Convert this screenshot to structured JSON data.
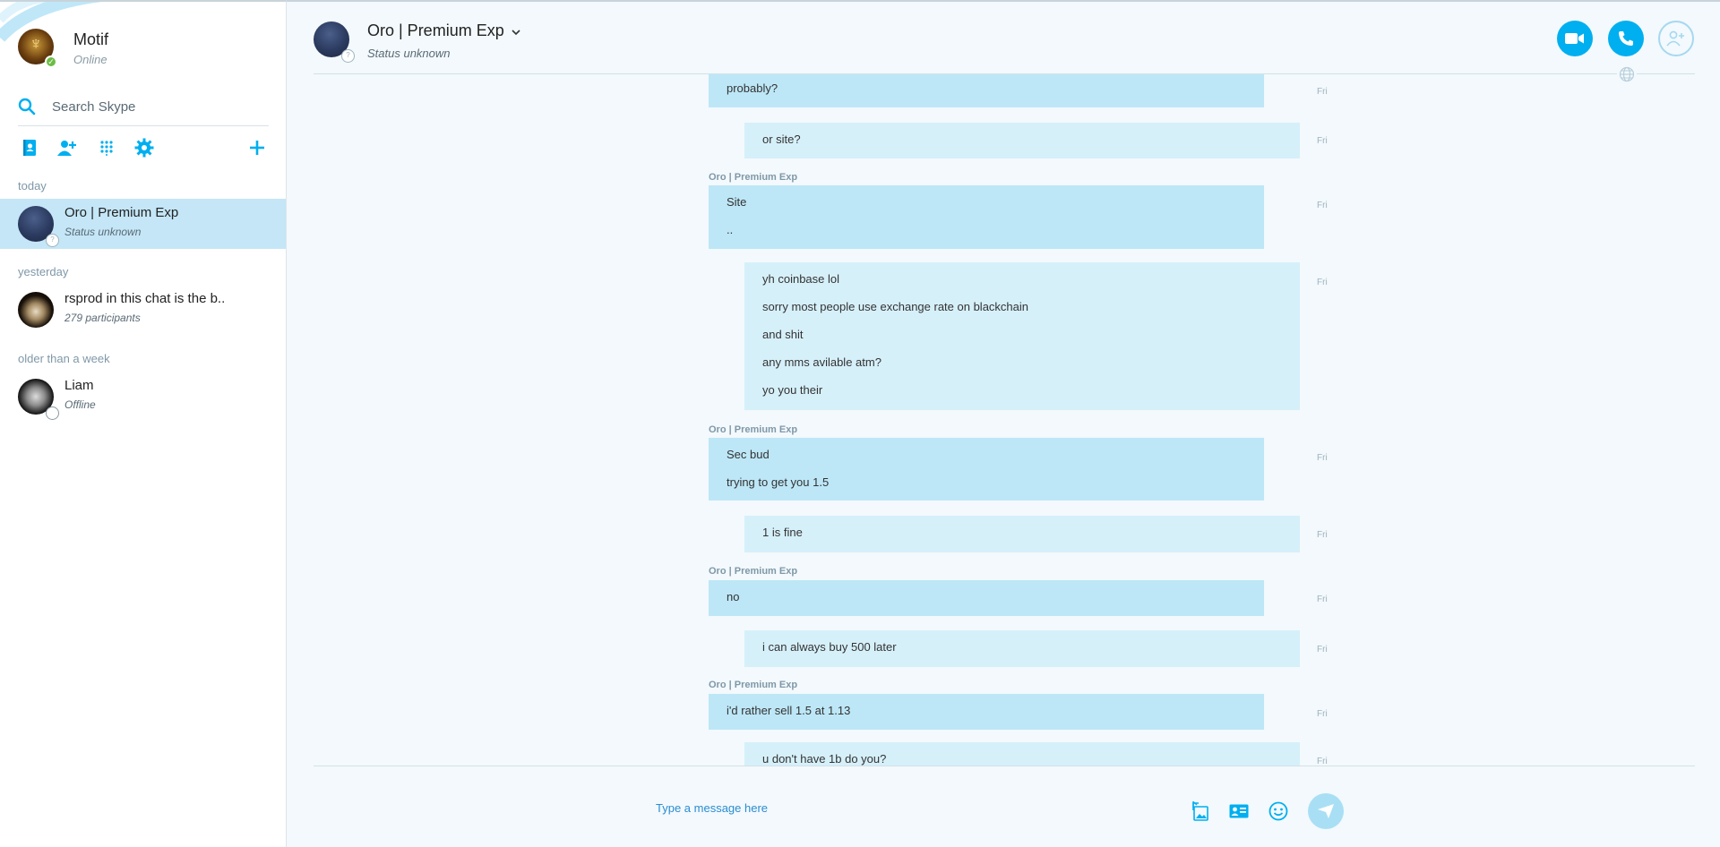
{
  "colors": {
    "accent": "#00aff0",
    "active_row": "#c4e6f7",
    "incoming_bubble": "#bde7f7",
    "outgoing_bubble": "#d6f0fa",
    "online": "#6cbd45"
  },
  "profile": {
    "name": "Motif",
    "status": "Online"
  },
  "search": {
    "placeholder": "Search Skype"
  },
  "toolbar": {
    "icons": [
      "contacts-icon",
      "add-contact-icon",
      "dialpad-icon",
      "settings-icon",
      "plus-icon"
    ]
  },
  "sections": {
    "today": "today",
    "yesterday": "yesterday",
    "older": "older than a week"
  },
  "conversations": [
    {
      "name": "Oro | Premium Exp",
      "subtitle": "Status unknown"
    },
    {
      "name": "rsprod in this chat is the b..",
      "subtitle": "279 participants"
    },
    {
      "name": "Liam",
      "subtitle": "Offline"
    }
  ],
  "header": {
    "title": "Oro | Premium Exp",
    "status": "Status unknown"
  },
  "messages": [
    {
      "direction": "in",
      "sender": "",
      "lines": [
        "probably?"
      ],
      "time": "Fri"
    },
    {
      "direction": "out",
      "sender": "",
      "lines": [
        "or site?"
      ],
      "time": "Fri"
    },
    {
      "direction": "in",
      "sender": "Oro | Premium Exp",
      "lines": [
        "Site",
        ".."
      ],
      "time": "Fri"
    },
    {
      "direction": "out",
      "sender": "",
      "lines": [
        "yh coinbase lol",
        "sorry most people use exchange rate on blackchain",
        "and shit",
        "any mms avilable atm?",
        "yo you their"
      ],
      "time": "Fri"
    },
    {
      "direction": "in",
      "sender": "Oro | Premium Exp",
      "lines": [
        "Sec bud",
        "trying to get you 1.5"
      ],
      "time": "Fri"
    },
    {
      "direction": "out",
      "sender": "",
      "lines": [
        "1 is fine"
      ],
      "time": "Fri"
    },
    {
      "direction": "in",
      "sender": "Oro | Premium Exp",
      "lines": [
        "no"
      ],
      "time": "Fri"
    },
    {
      "direction": "out",
      "sender": "",
      "lines": [
        "i can always buy 500 later"
      ],
      "time": "Fri"
    },
    {
      "direction": "in",
      "sender": "Oro | Premium Exp",
      "lines": [
        "i'd rather sell 1.5 at 1.13"
      ],
      "time": "Fri"
    },
    {
      "direction": "out",
      "sender": "",
      "lines": [
        "u don't have 1b do you?"
      ],
      "time": "Fri"
    }
  ],
  "composer": {
    "placeholder": "Type a message here"
  }
}
